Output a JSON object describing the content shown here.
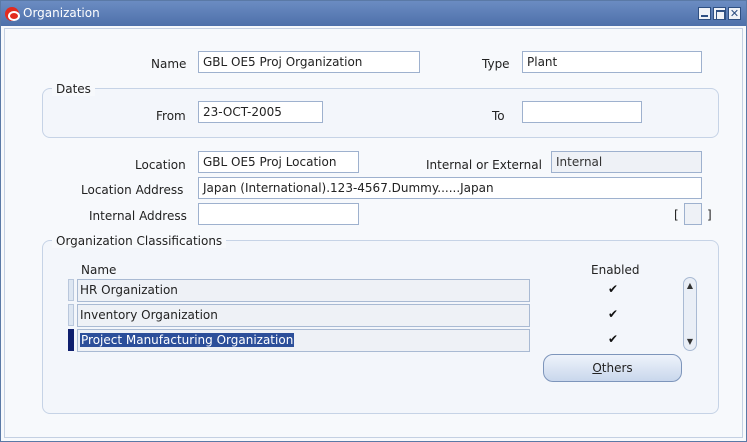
{
  "window": {
    "title": "Organization",
    "min_icon": "minimize-icon",
    "max_icon": "maximize-icon",
    "close_icon": "close-icon",
    "close_glyph": "✕"
  },
  "form": {
    "name_label": "Name",
    "name_value": "GBL OE5 Proj Organization",
    "type_label": "Type",
    "type_value": "Plant",
    "dates_group": "Dates",
    "from_label": "From",
    "from_value": "23-OCT-2005",
    "to_label": "To",
    "to_value": "",
    "location_label": "Location",
    "location_value": "GBL OE5 Proj Location",
    "int_ext_label": "Internal or External",
    "int_ext_value": "Internal",
    "location_address_label": "Location Address",
    "location_address_value": "Japan (International).123-4567.Dummy......Japan",
    "internal_address_label": "Internal Address",
    "internal_address_value": "",
    "bracket_left": "[",
    "bracket_right": "]"
  },
  "classifications": {
    "group_title": "Organization Classifications",
    "col_name": "Name",
    "col_enabled": "Enabled",
    "rows": [
      {
        "name": "HR Organization",
        "enabled": "✔"
      },
      {
        "name": "Inventory Organization",
        "enabled": "✔"
      },
      {
        "name": "Project Manufacturing Organization",
        "enabled": "✔"
      }
    ],
    "scroll_up": "▲",
    "scroll_down": "▼",
    "others_button_mnemonic": "O",
    "others_button_rest": "thers"
  },
  "colors": {
    "titlebar": "#4e70aa",
    "selection": "#2c4f9a",
    "current_row": "#0f1f6e"
  }
}
